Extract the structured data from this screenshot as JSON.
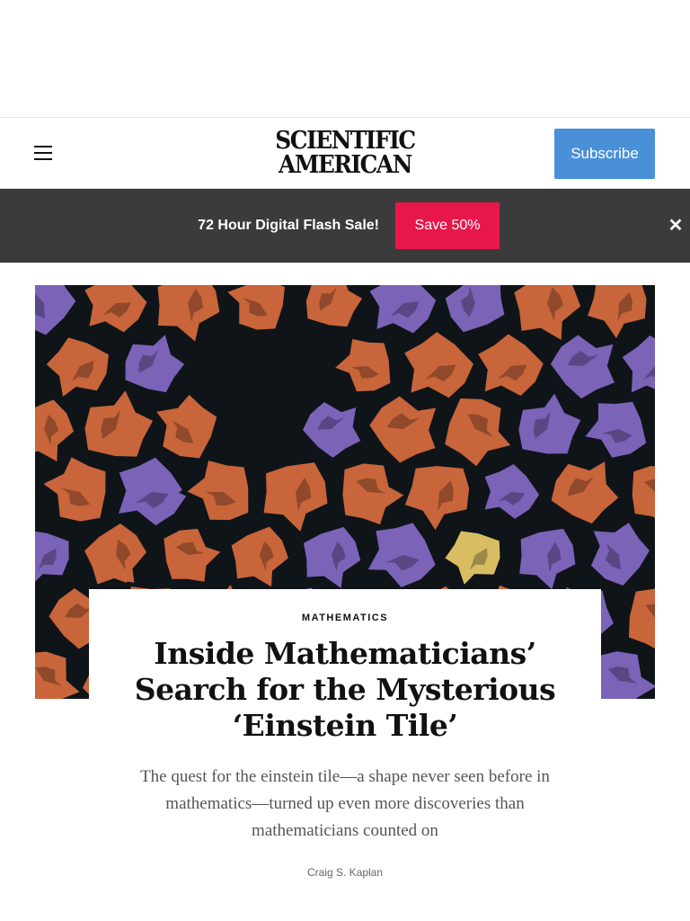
{
  "header": {
    "logo_line1": "SCIENTIFIC",
    "logo_line2": "AMERICAN",
    "subscribe_label": "Subscribe",
    "menu_icon": "hamburger-menu-icon"
  },
  "promo": {
    "text": "72 Hour Digital Flash Sale!",
    "button_label": "Save 50%",
    "close_symbol": "✕"
  },
  "hero": {
    "image_subject": "tiling of einstein hat tiles in orange, purple and one yellow tile on a dark background"
  },
  "article": {
    "kicker": "MATHEMATICS",
    "headline": "Inside Mathematicians’ Search for the Mysterious ‘Einstein Tile’",
    "dek": "The quest for the einstein tile—a shape never seen before in mathematics—turned up even more discoveries than mathematicians counted on",
    "byline": "Craig S. Kaplan"
  },
  "colors": {
    "subscribe": "#4a90d9",
    "promo_bar": "#3b3b3b",
    "promo_button": "#e8174a",
    "tile_orange": "#c8653a",
    "tile_purple": "#7b63b8",
    "tile_yellow": "#d9bd63",
    "tile_background": "#0f1419"
  }
}
